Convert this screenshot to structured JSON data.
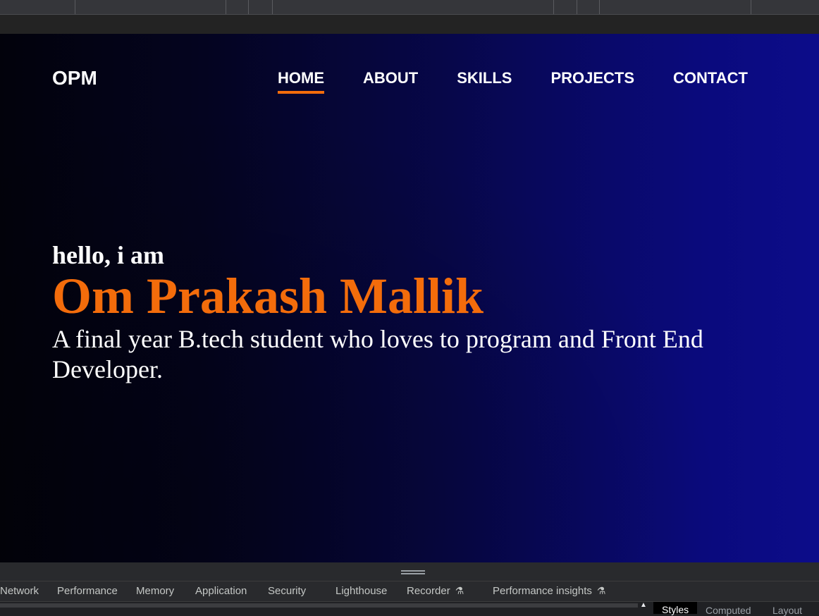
{
  "browser": {
    "devtools_tabs": [
      {
        "label": "Network",
        "experimental": false
      },
      {
        "label": "Performance",
        "experimental": false
      },
      {
        "label": "Memory",
        "experimental": false
      },
      {
        "label": "Application",
        "experimental": false
      },
      {
        "label": "Security",
        "experimental": false
      },
      {
        "label": "Lighthouse",
        "experimental": false
      },
      {
        "label": "Recorder",
        "experimental": true
      },
      {
        "label": "Performance insights",
        "experimental": true
      }
    ],
    "side_panel_tabs": [
      {
        "label": "Styles",
        "active": true
      },
      {
        "label": "Computed",
        "active": false
      },
      {
        "label": "Layout",
        "active": false
      }
    ]
  },
  "site": {
    "logo": "OPM",
    "nav": [
      {
        "label": "HOME",
        "active": true
      },
      {
        "label": "ABOUT",
        "active": false
      },
      {
        "label": "SKILLS",
        "active": false
      },
      {
        "label": "PROJECTS",
        "active": false
      },
      {
        "label": "CONTACT",
        "active": false
      }
    ],
    "hero": {
      "greeting": "hello, i am",
      "name": "Om Prakash Mallik",
      "tagline": "A final year B.tech student who loves to program and Front End Developer."
    }
  },
  "colors": {
    "accent": "#f36c0b",
    "background_dark": "#02020b",
    "background_blue": "#0c0c8a",
    "text": "#ffffff"
  },
  "icons": {
    "experimental": "flask-icon",
    "scroll_up": "triangle-up-icon",
    "resize": "drag-handle-icon"
  }
}
